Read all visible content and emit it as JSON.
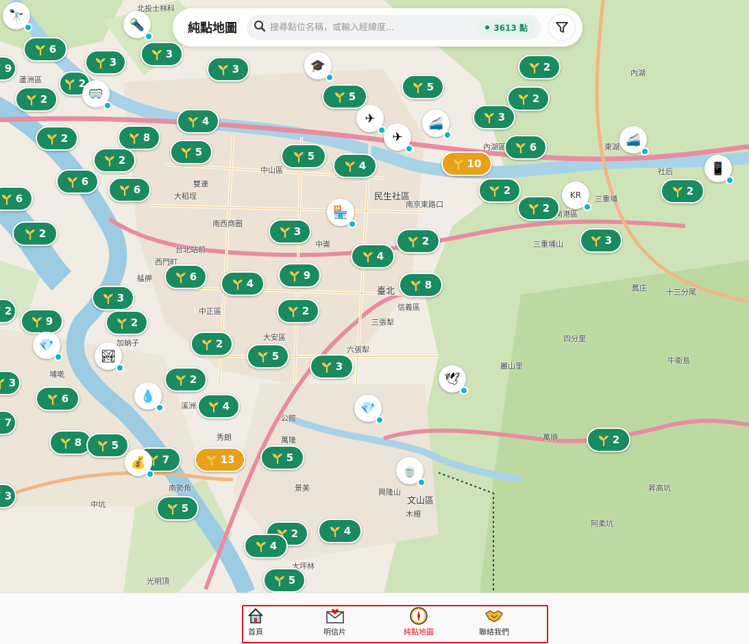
{
  "app": {
    "title": "純點地圖"
  },
  "search": {
    "placeholder": "搜尋點位名稱，或輸入經緯度...",
    "value": ""
  },
  "point_count": "3613 點",
  "colors": {
    "cluster_green": "#1a8a60",
    "cluster_orange": "#e9a11b",
    "poi_dot": "#13b5c6",
    "active_nav": "#e0141e"
  },
  "map_labels": [
    "北投士林科",
    "蘆洲區",
    "大稻埕",
    "雙連",
    "中山區",
    "民生社區",
    "南京東路口",
    "南西商圈",
    "台北站前",
    "西門町",
    "艋舺",
    "中正區",
    "大安區",
    "中崙",
    "臺北",
    "信義區",
    "三張犁",
    "六張犁",
    "埔墘",
    "加蚋子",
    "溪洲",
    "秀朗",
    "公館",
    "萬隆",
    "景美",
    "興隆山",
    "木柵",
    "文山區",
    "麗山里",
    "三重埔",
    "社后",
    "南港區",
    "內湖區",
    "東湖",
    "南勢角",
    "中坑",
    "大坪林",
    "光明頂",
    "昇高坑",
    "阿柔坑",
    "萬順",
    "四分里",
    "舊庄",
    "內湖",
    "三重埔山",
    "十三分尾",
    "牛衛島"
  ],
  "clusters": [
    {
      "count": "6",
      "color": "green"
    },
    {
      "count": "3",
      "color": "green"
    },
    {
      "count": "3",
      "color": "green"
    },
    {
      "count": "3",
      "color": "green"
    },
    {
      "count": "9",
      "color": "green"
    },
    {
      "count": "2",
      "color": "green"
    },
    {
      "count": "2",
      "color": "green"
    },
    {
      "count": "5",
      "color": "green"
    },
    {
      "count": "5",
      "color": "green"
    },
    {
      "count": "2",
      "color": "green"
    },
    {
      "count": "2",
      "color": "green"
    },
    {
      "count": "4",
      "color": "green"
    },
    {
      "count": "3",
      "color": "green"
    },
    {
      "count": "2",
      "color": "green"
    },
    {
      "count": "8",
      "color": "green"
    },
    {
      "count": "5",
      "color": "green"
    },
    {
      "count": "5",
      "color": "green"
    },
    {
      "count": "4",
      "color": "green"
    },
    {
      "count": "10",
      "color": "orange"
    },
    {
      "count": "6",
      "color": "green"
    },
    {
      "count": "2",
      "color": "green"
    },
    {
      "count": "6",
      "color": "green"
    },
    {
      "count": "6",
      "color": "green"
    },
    {
      "count": "6",
      "color": "green"
    },
    {
      "count": "2",
      "color": "green"
    },
    {
      "count": "2",
      "color": "green"
    },
    {
      "count": "2",
      "color": "green"
    },
    {
      "count": "2",
      "color": "green"
    },
    {
      "count": "3",
      "color": "green"
    },
    {
      "count": "2",
      "color": "green"
    },
    {
      "count": "3",
      "color": "green"
    },
    {
      "count": "4",
      "color": "green"
    },
    {
      "count": "6",
      "color": "green"
    },
    {
      "count": "4",
      "color": "green"
    },
    {
      "count": "9",
      "color": "green"
    },
    {
      "count": "8",
      "color": "green"
    },
    {
      "count": "3",
      "color": "green"
    },
    {
      "count": "2",
      "color": "green"
    },
    {
      "count": "9",
      "color": "green"
    },
    {
      "count": "2",
      "color": "green"
    },
    {
      "count": "2",
      "color": "green"
    },
    {
      "count": "2",
      "color": "green"
    },
    {
      "count": "5",
      "color": "green"
    },
    {
      "count": "3",
      "color": "green"
    },
    {
      "count": "3",
      "color": "green"
    },
    {
      "count": "6",
      "color": "green"
    },
    {
      "count": "2",
      "color": "green"
    },
    {
      "count": "4",
      "color": "green"
    },
    {
      "count": "7",
      "color": "green"
    },
    {
      "count": "8",
      "color": "green"
    },
    {
      "count": "5",
      "color": "green"
    },
    {
      "count": "7",
      "color": "green"
    },
    {
      "count": "13",
      "color": "orange"
    },
    {
      "count": "5",
      "color": "green"
    },
    {
      "count": "2",
      "color": "green"
    },
    {
      "count": "3",
      "color": "green"
    },
    {
      "count": "5",
      "color": "green"
    },
    {
      "count": "2",
      "color": "green"
    },
    {
      "count": "4",
      "color": "green"
    },
    {
      "count": "4",
      "color": "green"
    },
    {
      "count": "5",
      "color": "green"
    }
  ],
  "pois": [
    {
      "icon": "telescope-icon"
    },
    {
      "icon": "lamp-icon"
    },
    {
      "icon": "binoculars-icon"
    },
    {
      "icon": "hat-icon"
    },
    {
      "icon": "airplane-icon"
    },
    {
      "icon": "airplane-icon"
    },
    {
      "icon": "train-icon"
    },
    {
      "icon": "train-icon"
    },
    {
      "icon": "tablet-icon"
    },
    {
      "icon": "shop-icon"
    },
    {
      "icon": "korean-badge-icon",
      "text": "KR"
    },
    {
      "icon": "gem-icon"
    },
    {
      "icon": "mountain-photo-icon"
    },
    {
      "icon": "water-drop-icon"
    },
    {
      "icon": "tea-cup-icon"
    },
    {
      "icon": "bird-icon"
    },
    {
      "icon": "gem-icon"
    },
    {
      "icon": "coin-bag-icon"
    }
  ],
  "nav": [
    {
      "label": "首頁",
      "icon": "home-icon",
      "active": false
    },
    {
      "label": "明信片",
      "icon": "postcard-icon",
      "active": false
    },
    {
      "label": "純點地圖",
      "icon": "compass-icon",
      "active": true
    },
    {
      "label": "聯絡我們",
      "icon": "handshake-icon",
      "active": false
    }
  ]
}
